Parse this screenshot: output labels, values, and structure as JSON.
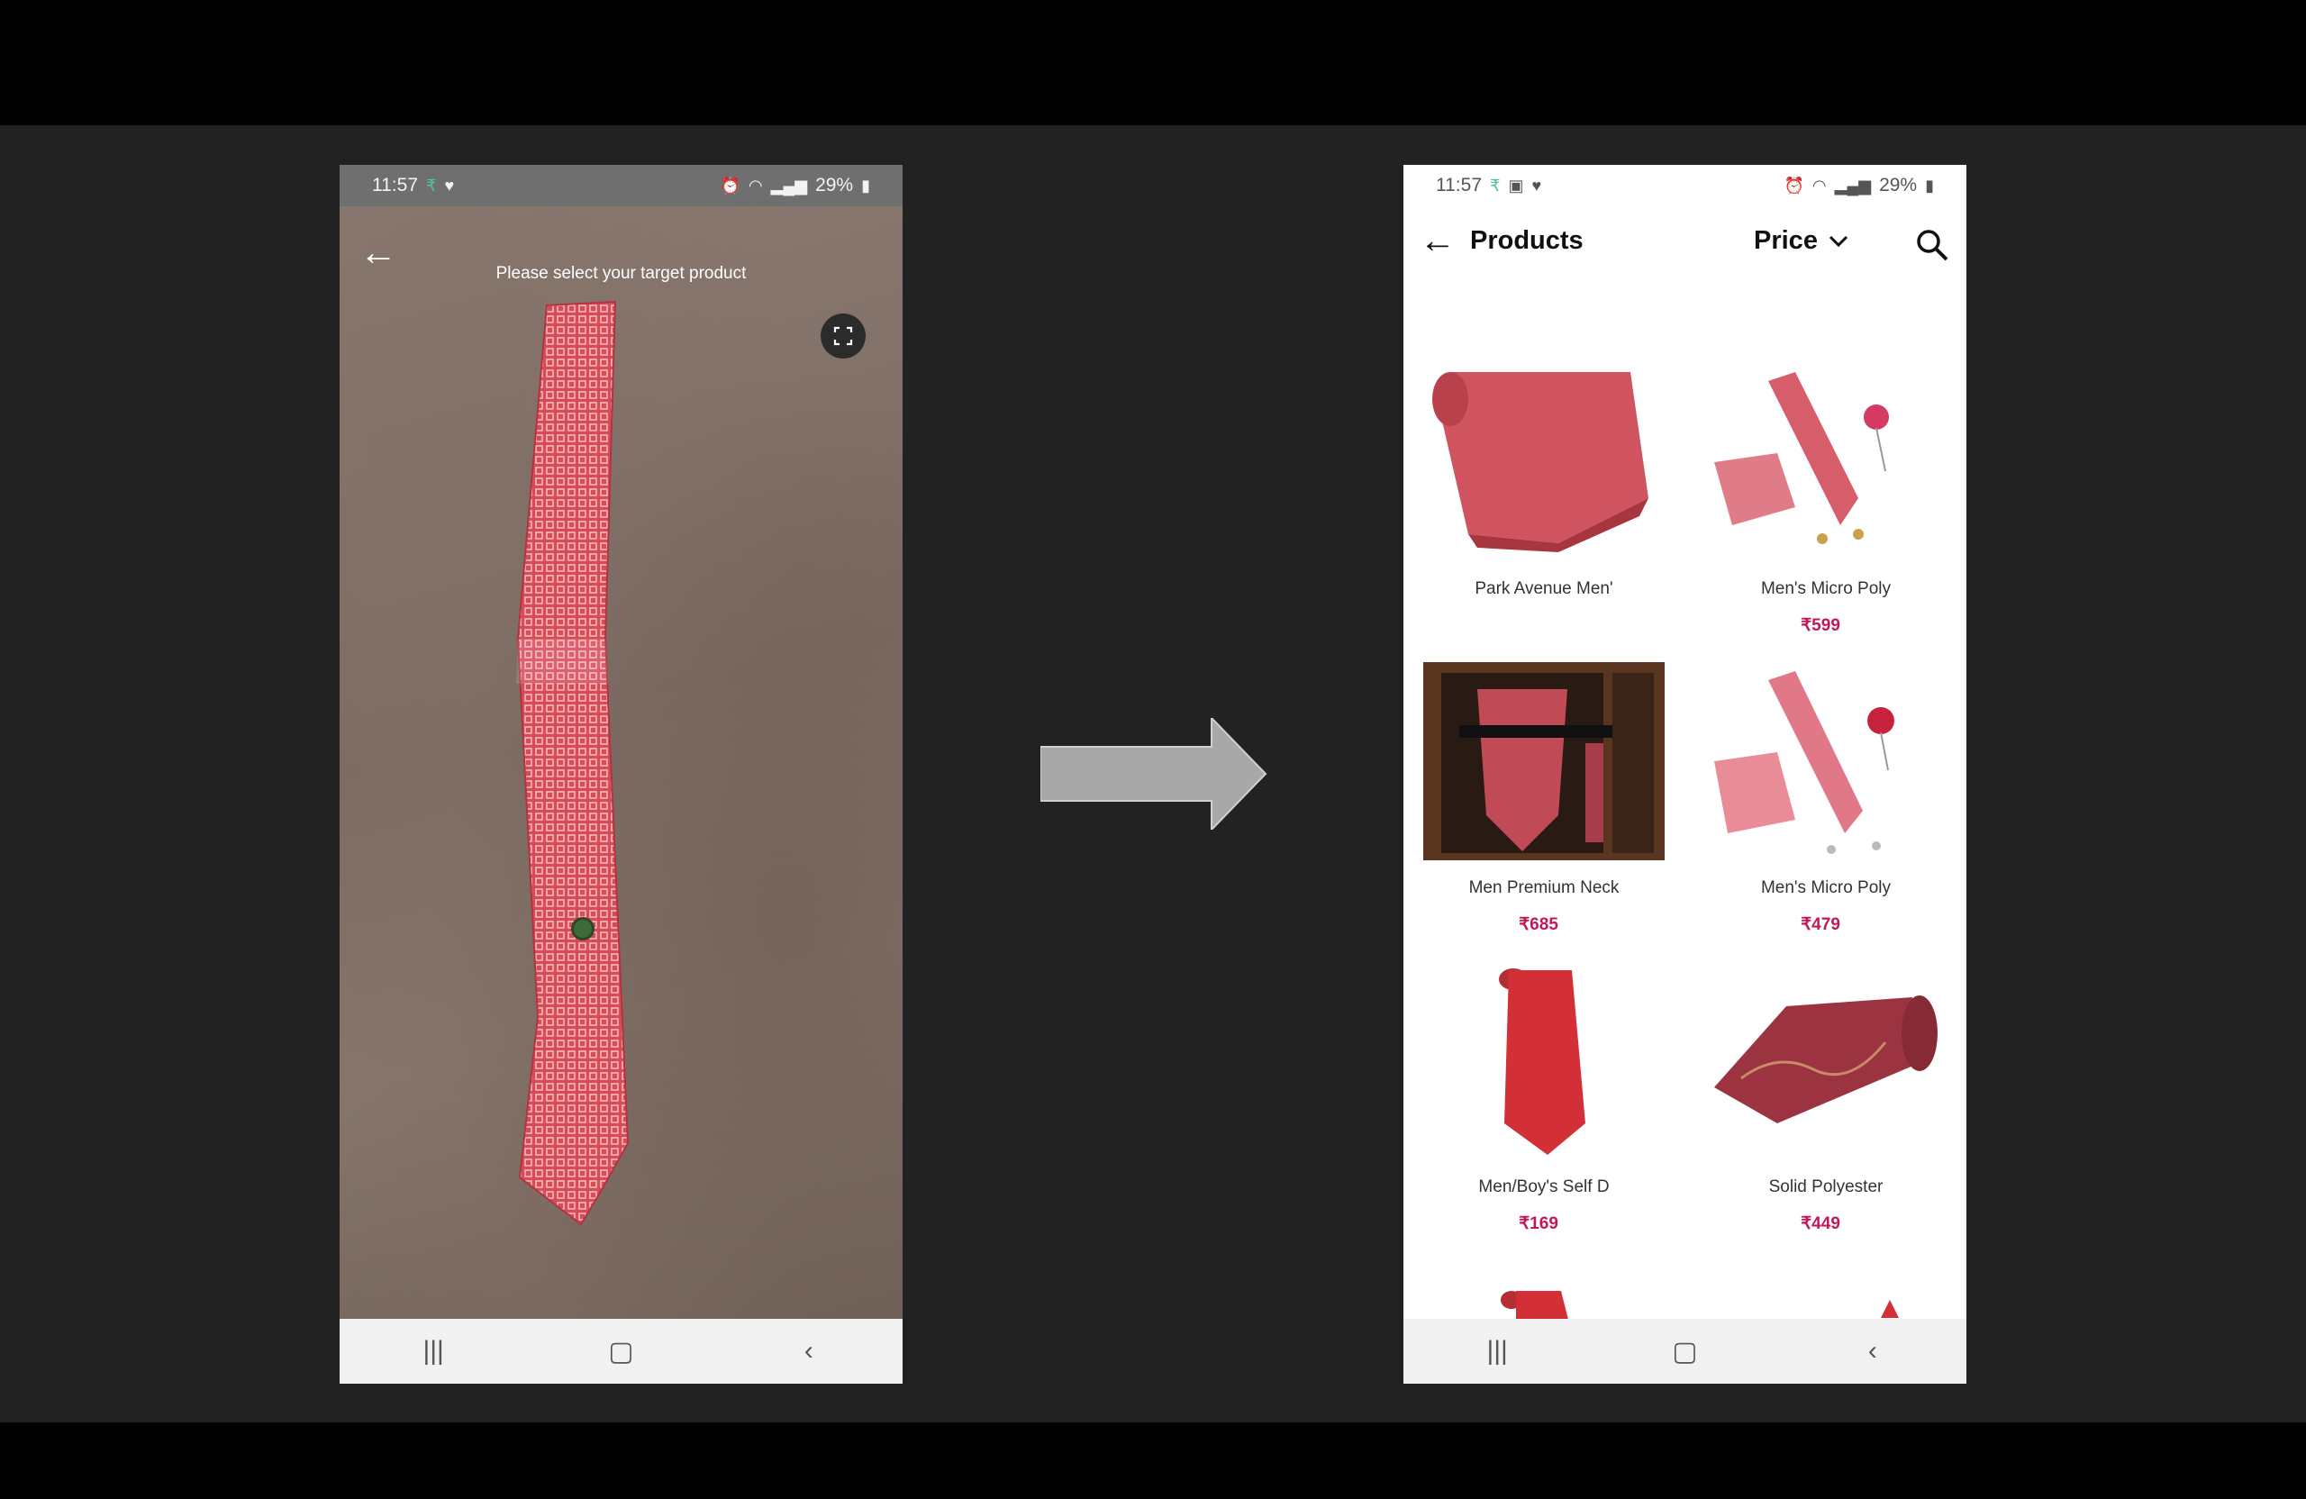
{
  "left_screen": {
    "status": {
      "time": "11:57",
      "battery": "29%",
      "icons": [
        "rupee-icon",
        "heart-icon",
        "alarm-icon",
        "wifi-icon",
        "signal-icon",
        "signal-icon",
        "battery-icon"
      ]
    },
    "hint": "Please select your target product",
    "icons": [
      "back-arrow-icon",
      "expand-icon"
    ]
  },
  "right_screen": {
    "status": {
      "time": "11:57",
      "battery": "29%"
    },
    "header": {
      "title": "Products",
      "sort_label": "Price"
    },
    "products": [
      {
        "name": "Park Avenue Men'",
        "price": ""
      },
      {
        "name": "Men's Micro Poly",
        "price": "₹599"
      },
      {
        "name": "Men Premium Neck",
        "price": "₹685"
      },
      {
        "name": "Men's Micro Poly",
        "price": "₹479"
      },
      {
        "name": "Men/Boy's Self D",
        "price": "₹169"
      },
      {
        "name": "Solid Polyester",
        "price": "₹449"
      }
    ]
  },
  "nav_icons": [
    "recent-apps-icon",
    "home-icon",
    "back-icon"
  ],
  "colors": {
    "accent_price": "#c2185b",
    "tie_red": "#d94a57",
    "background": "#222222"
  }
}
